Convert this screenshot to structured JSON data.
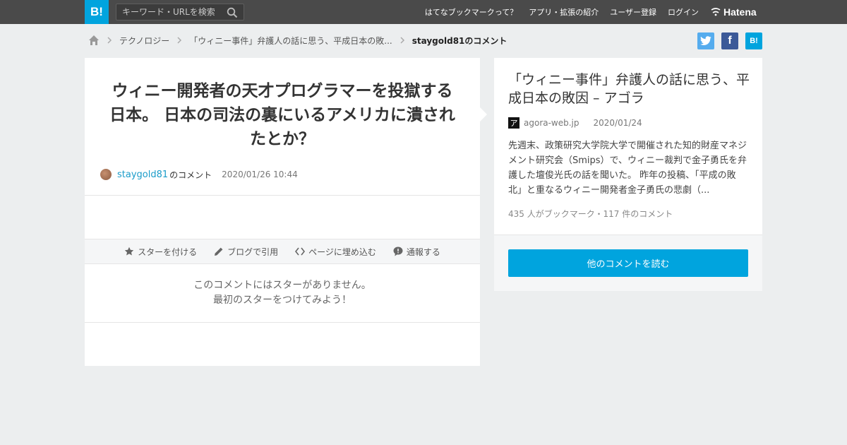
{
  "header": {
    "logo": "B!",
    "search_placeholder": "キーワード・URLを検索",
    "nav": [
      "はてなブックマークって？",
      "アプリ・拡張の紹介",
      "ユーザー登録",
      "ログイン"
    ],
    "hatena_label": "Hatena"
  },
  "breadcrumb": {
    "items": [
      "テクノロジー",
      "「ウィニー事件」弁護人の話に思う、平成日本の敗..."
    ],
    "current": "staygold81のコメント"
  },
  "share": {
    "facebook": "f",
    "hatebu": "B!"
  },
  "comment": {
    "text": "ウィニー開発者の天才プログラマーを投獄する日本。 日本の司法の裏にいるアメリカに潰されたとか？",
    "user": "staygold81",
    "user_suffix": "のコメント",
    "datetime": "2020/01/26 10:44"
  },
  "actions": {
    "star": "スターを付ける",
    "blog": "ブログで引用",
    "embed": "ページに埋め込む",
    "report": "通報する"
  },
  "no_star": {
    "line1": "このコメントにはスターがありません。",
    "line2": "最初のスターをつけてみよう！"
  },
  "entry": {
    "title": "「ウィニー事件」弁護人の話に思う、平成日本の敗因 – アゴラ",
    "favicon": "ア",
    "site": "agora-web.jp",
    "date": "2020/01/24",
    "summary": "先週末、政策研究大学院大学で開催された知的財産マネジメント研究会（Smips）で、ウィニー裁判で金子勇氏を弁護した壇俊光氏の話を聞いた。 昨年の投稿、「平成の敗北」と重なるウィニー開発者金子勇氏の悲劇（...",
    "counts": "435 人がブックマーク・117 件のコメント",
    "button": "他のコメントを読む"
  },
  "colors": {
    "brand": "#00a4de",
    "topbar": "#4a4a4a",
    "link": "#1a9cc9"
  }
}
